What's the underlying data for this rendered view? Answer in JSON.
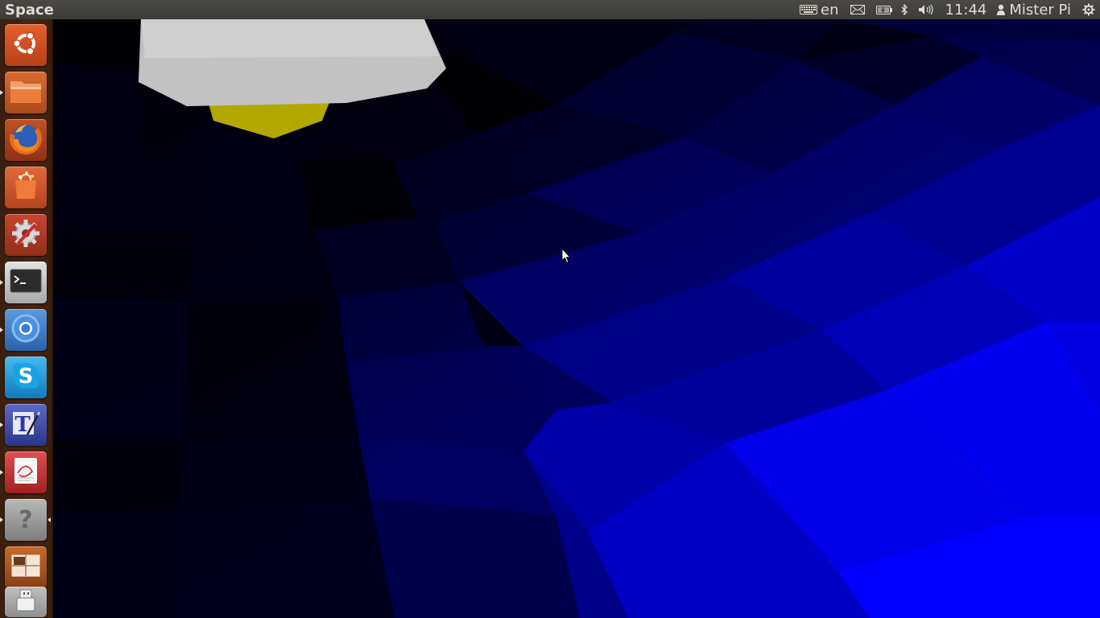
{
  "topbar": {
    "app_title": "Space",
    "keyboard_layout": "en",
    "clock": "11:44",
    "user_name": "Mister Pi",
    "icons": [
      "keyboard-icon",
      "mail-icon",
      "battery-icon",
      "bluetooth-icon",
      "volume-icon",
      "user-icon",
      "session-gear-icon"
    ]
  },
  "launcher": {
    "items": [
      {
        "name": "dash-home",
        "icon": "ubuntu-logo-icon",
        "color": "#e0561e"
      },
      {
        "name": "files",
        "icon": "folder-icon",
        "color": "#e07030"
      },
      {
        "name": "firefox",
        "icon": "firefox-icon",
        "color": "#b34a1a"
      },
      {
        "name": "software-center",
        "icon": "shopping-bag-icon",
        "color": "#d9542b"
      },
      {
        "name": "system-settings",
        "icon": "settings-wrench-icon",
        "color": "#b9442a"
      },
      {
        "name": "terminal",
        "icon": "terminal-icon",
        "color": "#cfcfcf"
      },
      {
        "name": "chromium",
        "icon": "chromium-icon",
        "color": "#3d7fc9"
      },
      {
        "name": "skype",
        "icon": "skype-icon",
        "color": "#1c9fd9"
      },
      {
        "name": "text-editor",
        "icon": "text-editor-icon",
        "color": "#3f4aa8"
      },
      {
        "name": "document-viewer",
        "icon": "document-viewer-icon",
        "color": "#c93333"
      },
      {
        "name": "help",
        "icon": "question-icon",
        "color": "#8a8a8a"
      },
      {
        "name": "workspace-switcher",
        "icon": "workspace-icon",
        "color": "#b05a22"
      },
      {
        "name": "usb-drive",
        "icon": "usb-drive-icon",
        "color": "#a9a9a9"
      }
    ]
  },
  "scene": {
    "description_color_primary": "#0000ff",
    "description_color_dark": "#00001a"
  }
}
